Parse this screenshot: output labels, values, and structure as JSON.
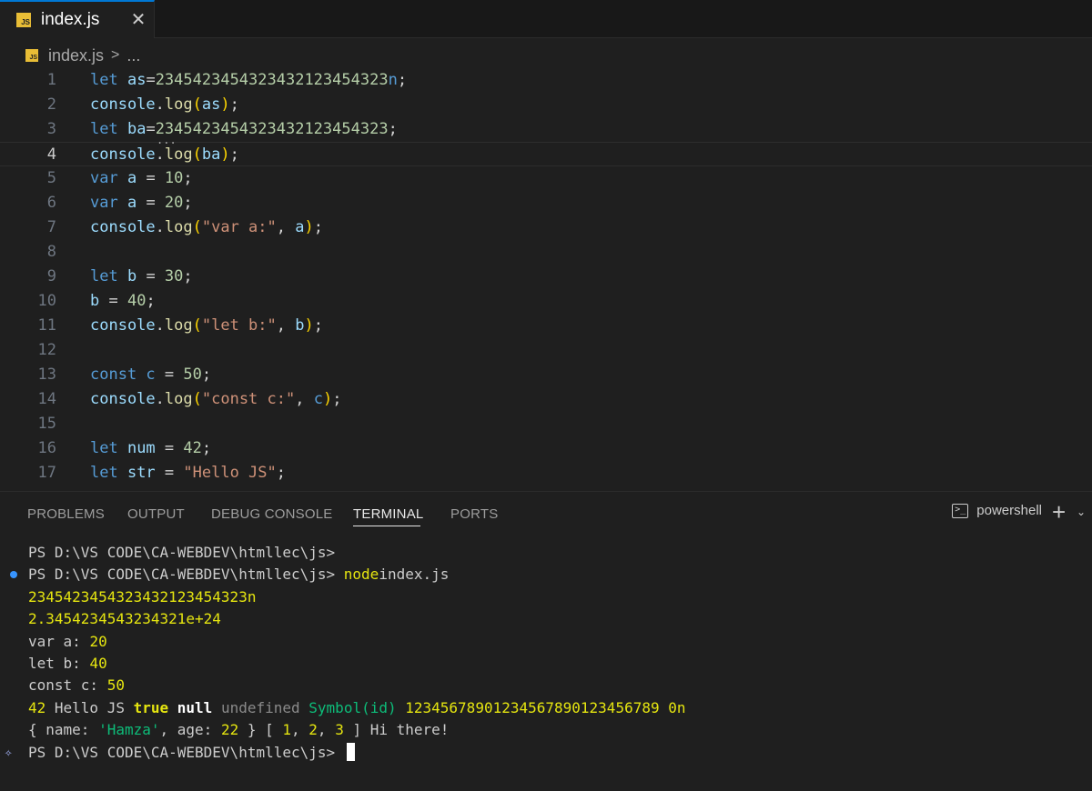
{
  "tab": {
    "file_icon": "JS",
    "title": "index.js",
    "close_glyph": "✕"
  },
  "breadcrumb": {
    "file_icon": "JS",
    "file": "index.js",
    "separator": ">",
    "more": "..."
  },
  "editor": {
    "current_line": 4,
    "line_numbers": [
      "1",
      "2",
      "3",
      "4",
      "5",
      "6",
      "7",
      "8",
      "9",
      "10",
      "11",
      "12",
      "13",
      "14",
      "15",
      "16",
      "17"
    ],
    "lines": [
      [
        [
          "k",
          "let"
        ],
        [
          "v",
          " as"
        ],
        [
          "o",
          "="
        ],
        [
          "n",
          "2345423454323432123454323"
        ],
        [
          "k",
          "n"
        ],
        [
          "o",
          ";"
        ]
      ],
      [
        [
          "v",
          "console"
        ],
        [
          "o",
          "."
        ],
        [
          "f",
          "log"
        ],
        [
          "p",
          "("
        ],
        [
          "v",
          "as"
        ],
        [
          "p",
          ")"
        ],
        [
          "o",
          ";"
        ]
      ],
      [
        [
          "k",
          "let"
        ],
        [
          "v",
          " ba"
        ],
        [
          "o",
          "="
        ],
        [
          "n",
          "2345423454323432123454323"
        ],
        [
          "o",
          ";"
        ]
      ],
      [
        [
          "v",
          "console"
        ],
        [
          "o",
          "."
        ],
        [
          "f",
          "log"
        ],
        [
          "p",
          "("
        ],
        [
          "v",
          "ba"
        ],
        [
          "p",
          ")"
        ],
        [
          "o",
          ";"
        ]
      ],
      [
        [
          "k",
          "var"
        ],
        [
          "v",
          " a"
        ],
        [
          "o",
          " = "
        ],
        [
          "n",
          "10"
        ],
        [
          "o",
          ";"
        ]
      ],
      [
        [
          "k",
          "var"
        ],
        [
          "v",
          " a"
        ],
        [
          "o",
          " = "
        ],
        [
          "n",
          "20"
        ],
        [
          "o",
          ";"
        ]
      ],
      [
        [
          "v",
          "console"
        ],
        [
          "o",
          "."
        ],
        [
          "f",
          "log"
        ],
        [
          "p",
          "("
        ],
        [
          "s",
          "\"var a:\""
        ],
        [
          "o",
          ", "
        ],
        [
          "v",
          "a"
        ],
        [
          "p",
          ")"
        ],
        [
          "o",
          ";"
        ]
      ],
      [],
      [
        [
          "k",
          "let"
        ],
        [
          "v",
          " b"
        ],
        [
          "o",
          " = "
        ],
        [
          "n",
          "30"
        ],
        [
          "o",
          ";"
        ]
      ],
      [
        [
          "v",
          "b"
        ],
        [
          "o",
          " = "
        ],
        [
          "n",
          "40"
        ],
        [
          "o",
          ";"
        ]
      ],
      [
        [
          "v",
          "console"
        ],
        [
          "o",
          "."
        ],
        [
          "f",
          "log"
        ],
        [
          "p",
          "("
        ],
        [
          "s",
          "\"let b:\""
        ],
        [
          "o",
          ", "
        ],
        [
          "v",
          "b"
        ],
        [
          "p",
          ")"
        ],
        [
          "o",
          ";"
        ]
      ],
      [],
      [
        [
          "k",
          "const"
        ],
        [
          "k",
          " c"
        ],
        [
          "o",
          " = "
        ],
        [
          "n",
          "50"
        ],
        [
          "o",
          ";"
        ]
      ],
      [
        [
          "v",
          "console"
        ],
        [
          "o",
          "."
        ],
        [
          "f",
          "log"
        ],
        [
          "p",
          "("
        ],
        [
          "s",
          "\"const c:\""
        ],
        [
          "o",
          ", "
        ],
        [
          "k",
          "c"
        ],
        [
          "p",
          ")"
        ],
        [
          "o",
          ";"
        ]
      ],
      [],
      [
        [
          "k",
          "let"
        ],
        [
          "v",
          " num"
        ],
        [
          "o",
          " = "
        ],
        [
          "n",
          "42"
        ],
        [
          "o",
          ";"
        ]
      ],
      [
        [
          "k",
          "let"
        ],
        [
          "v",
          " str"
        ],
        [
          "o",
          " = "
        ],
        [
          "s",
          "\"Hello JS\""
        ],
        [
          "o",
          ";"
        ]
      ]
    ]
  },
  "panel": {
    "tabs": [
      "PROBLEMS",
      "OUTPUT",
      "DEBUG CONSOLE",
      "TERMINAL",
      "PORTS"
    ],
    "active_tab": "TERMINAL",
    "shell_name": "powershell",
    "shell_icon": ">_",
    "add_glyph": "+",
    "dropdown_glyph": "⌄"
  },
  "terminal": {
    "lines": [
      [
        [
          "",
          "PS D:\\VS CODE\\CA-WEBDEV\\htmllec\\js>"
        ]
      ],
      [
        [
          "",
          "PS D:\\VS CODE\\CA-WEBDEV\\htmllec\\js> "
        ],
        [
          "y",
          "node"
        ],
        [
          "",
          "index.js"
        ]
      ],
      [
        [
          "y",
          "2345423454323432123454323n"
        ]
      ],
      [
        [
          "y",
          "2.3454234543234321e+24"
        ]
      ],
      [
        [
          "",
          "var a: "
        ],
        [
          "y",
          "20"
        ]
      ],
      [
        [
          "",
          "let b: "
        ],
        [
          "y",
          "40"
        ]
      ],
      [
        [
          "",
          "const c: "
        ],
        [
          "y",
          "50"
        ]
      ],
      [
        [
          "y",
          "42"
        ],
        [
          "",
          " Hello JS "
        ],
        [
          "yb",
          "true"
        ],
        [
          "",
          " "
        ],
        [
          "b",
          "null"
        ],
        [
          "",
          " "
        ],
        [
          "gr",
          "undefined"
        ],
        [
          "",
          " "
        ],
        [
          "g",
          "Symbol(id)"
        ],
        [
          "",
          " "
        ],
        [
          "y",
          "12345678901234567890123456789 0n"
        ]
      ],
      [
        [
          "",
          "{ name: "
        ],
        [
          "g",
          "'Hamza'"
        ],
        [
          "",
          ", age: "
        ],
        [
          "y",
          "22"
        ],
        [
          "",
          " } [ "
        ],
        [
          "y",
          "1"
        ],
        [
          "",
          ", "
        ],
        [
          "y",
          "2"
        ],
        [
          "",
          ", "
        ],
        [
          "y",
          "3"
        ],
        [
          "",
          " ] Hi there!"
        ]
      ],
      [
        [
          "",
          "PS D:\\VS CODE\\CA-WEBDEV\\htmllec\\js> "
        ]
      ]
    ],
    "decorations": {
      "success_dot_line": 2,
      "sparkle_line": 10,
      "sparkle_glyph": "✧"
    }
  },
  "colors": {
    "keyword": "#569cd6",
    "variable": "#9cdcfe",
    "number": "#b5cea8",
    "string": "#ce9178",
    "function": "#dcdcaa",
    "bracket": "#ffd700",
    "terminal_yellow": "#e5e510",
    "terminal_green": "#0dbc79",
    "accent": "#0078d4"
  }
}
